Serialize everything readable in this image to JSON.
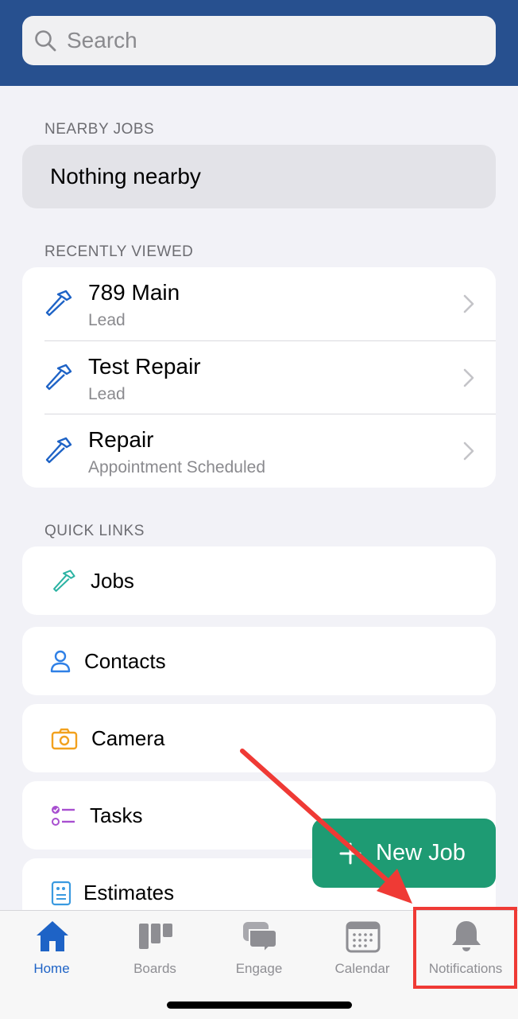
{
  "search": {
    "placeholder": "Search",
    "icon": "search-icon"
  },
  "nearby": {
    "heading": "NEARBY JOBS",
    "empty_text": "Nothing nearby"
  },
  "recent": {
    "heading": "RECENTLY VIEWED",
    "items": [
      {
        "title": "789 Main",
        "status": "Lead",
        "icon": "hammer-icon"
      },
      {
        "title": "Test Repair",
        "status": "Lead",
        "icon": "hammer-icon"
      },
      {
        "title": "Repair",
        "status": "Appointment Scheduled",
        "icon": "hammer-icon"
      }
    ]
  },
  "quick_links": {
    "heading": "QUICK LINKS",
    "items": [
      {
        "label": "Jobs",
        "icon": "hammer-icon",
        "color": "#2bb3a3"
      },
      {
        "label": "Contacts",
        "icon": "person-icon",
        "color": "#2f80e6"
      },
      {
        "label": "Camera",
        "icon": "camera-icon",
        "color": "#f2a11e"
      },
      {
        "label": "Tasks",
        "icon": "checklist-icon",
        "color": "#a84fd0"
      },
      {
        "label": "Estimates",
        "icon": "estimate-icon",
        "color": "#3a9ae0"
      }
    ]
  },
  "fab": {
    "label": "New Job",
    "icon": "plus-icon",
    "color": "#1e9b73"
  },
  "tabbar": {
    "tabs": [
      {
        "label": "Home",
        "icon": "home-icon",
        "active": true
      },
      {
        "label": "Boards",
        "icon": "boards-icon",
        "active": false
      },
      {
        "label": "Engage",
        "icon": "chat-icon",
        "active": false
      },
      {
        "label": "Calendar",
        "icon": "calendar-icon",
        "active": false
      },
      {
        "label": "Notifications",
        "icon": "bell-icon",
        "active": false
      }
    ]
  },
  "colors": {
    "header": "#27508f",
    "accent": "#1e63c6",
    "annotation": "#ef3a35"
  }
}
